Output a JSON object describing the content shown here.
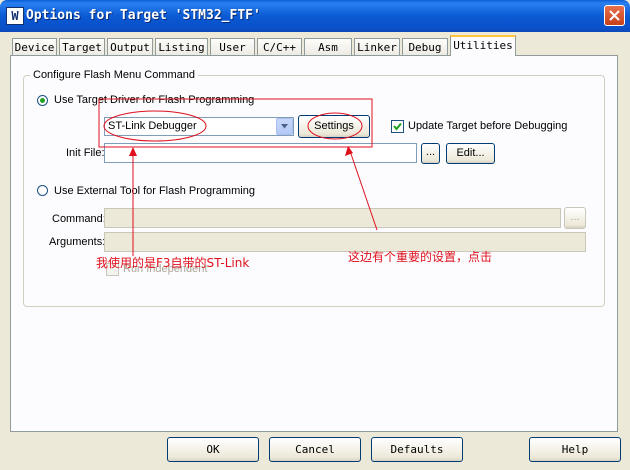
{
  "window": {
    "title": "Options for Target 'STM32_FTF'",
    "app_icon_letter": "W"
  },
  "tabs": [
    {
      "label": "Device"
    },
    {
      "label": "Target"
    },
    {
      "label": "Output"
    },
    {
      "label": "Listing"
    },
    {
      "label": "User"
    },
    {
      "label": "C/C++"
    },
    {
      "label": "Asm"
    },
    {
      "label": "Linker"
    },
    {
      "label": "Debug"
    },
    {
      "label": "Utilities"
    }
  ],
  "active_tab": "Utilities",
  "group": {
    "legend": "Configure Flash Menu Command",
    "use_target_driver_label": "Use Target Driver for Flash Programming",
    "driver_value": "ST-Link Debugger",
    "settings_label": "Settings",
    "update_target_label": "Update Target before Debugging",
    "init_file_label": "Init File:",
    "init_file_value": "",
    "browse_label": "...",
    "edit_label": "Edit...",
    "use_external_tool_label": "Use External Tool for Flash Programming",
    "command_label": "Command:",
    "command_value": "",
    "arguments_label": "Arguments:",
    "arguments_value": "",
    "run_independent_label": "Run Independent"
  },
  "annotations": {
    "note_left": "我使用的是F3自带的ST-Link",
    "note_right": "这边有个重要的设置，点击",
    "color": "#e0101c"
  },
  "footer": {
    "ok": "OK",
    "cancel": "Cancel",
    "defaults": "Defaults",
    "help": "Help"
  }
}
